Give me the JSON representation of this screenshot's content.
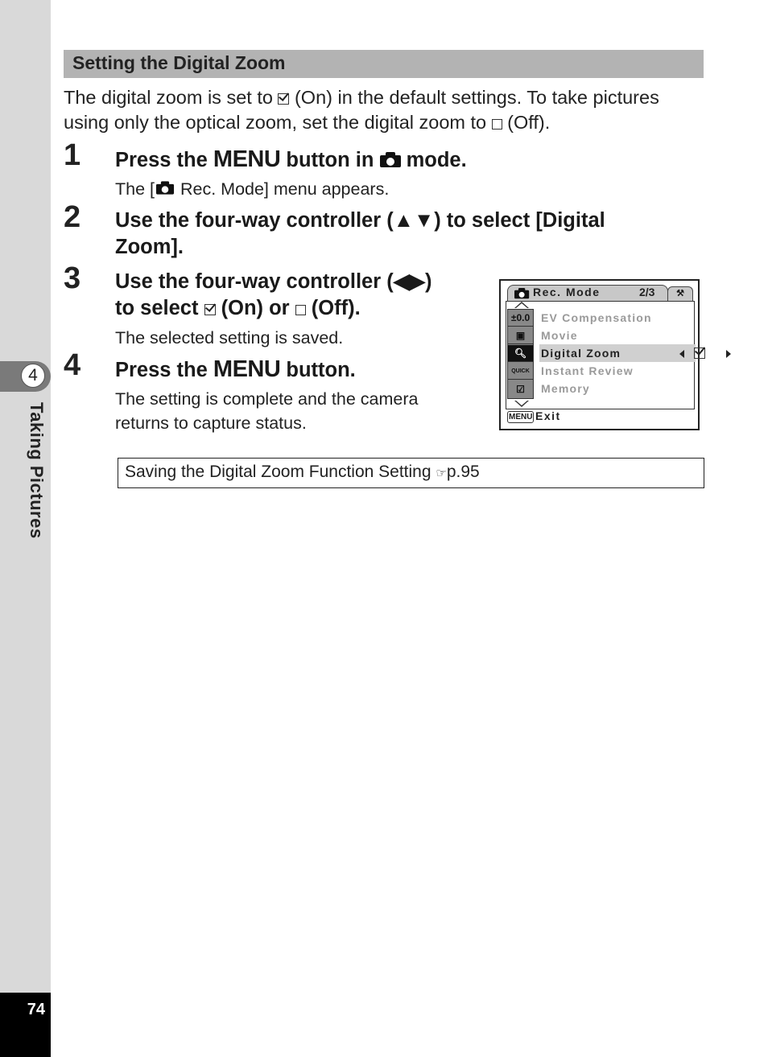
{
  "sidebar": {
    "chapter_number": "4",
    "chapter_title": "Taking Pictures",
    "page_number": "74"
  },
  "section": {
    "title": "Setting the Digital Zoom",
    "intro_part1": "The digital zoom is set to ",
    "intro_part2": " (On) in the default settings. To take pictures using only the optical zoom, set the digital zoom to ",
    "intro_part3": " (Off)."
  },
  "steps": [
    {
      "number": "1",
      "title_a": "Press the ",
      "title_menu": "MENU",
      "title_b": " button in ",
      "title_c": " mode.",
      "desc_a": "The [",
      "desc_b": " Rec. Mode] menu appears."
    },
    {
      "number": "2",
      "title_line1": "Use the four-way controller (▲▼) to select [Digital",
      "title_line2": "Zoom]."
    },
    {
      "number": "3",
      "title_line1": "Use the four-way controller (◀▶)",
      "title_line2_a": "to select ",
      "title_line2_b": " (On) or ",
      "title_line2_c": " (Off).",
      "desc": "The selected setting is saved."
    },
    {
      "number": "4",
      "title_a": "Press the ",
      "title_menu": "MENU",
      "title_b": " button.",
      "desc_line1": "The setting is complete and the camera",
      "desc_line2": "returns to capture status."
    }
  ],
  "lcd": {
    "tab_title": "Rec. Mode",
    "page_indicator": "2/3",
    "setup_tab_icon": "wrench-icon",
    "items": [
      {
        "icon_text": "±0.0",
        "label": "EV Compensation",
        "selected": false
      },
      {
        "icon_text": "▣",
        "label": "Movie",
        "selected": false
      },
      {
        "icon_text": "Q",
        "label": "Digital Zoom",
        "selected": true
      },
      {
        "icon_text": "QUICK",
        "label": "Instant Review",
        "selected": false
      },
      {
        "icon_text": "☑",
        "label": "Memory",
        "selected": false
      }
    ],
    "selected_value": "On",
    "menu_button": "MENU",
    "exit_label": "Exit"
  },
  "reference": {
    "text": "Saving the Digital Zoom Function Setting ",
    "pointer": "☞",
    "page": "p.95"
  }
}
